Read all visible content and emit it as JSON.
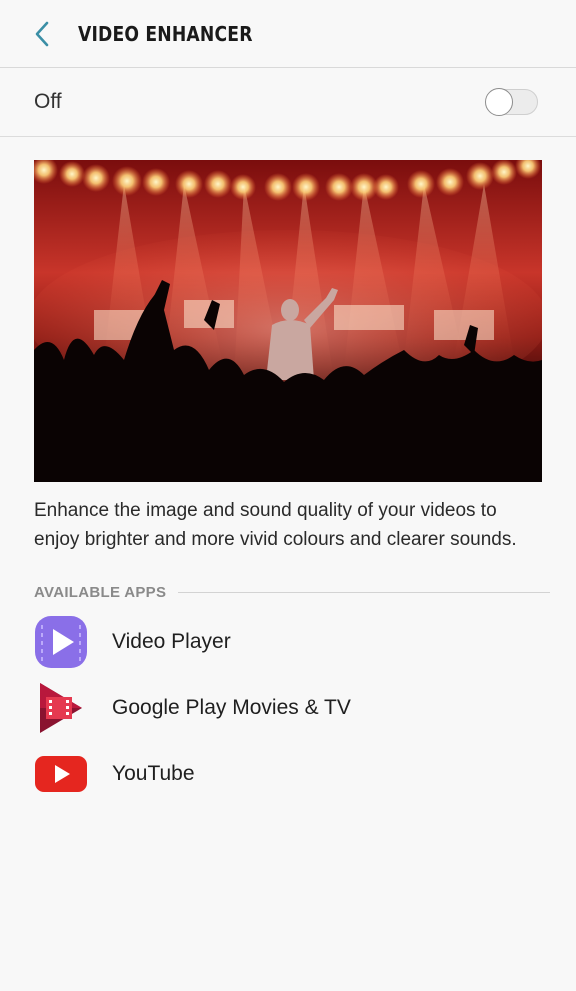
{
  "header": {
    "title": "VIDEO ENHANCER",
    "back_icon": "chevron-left-icon",
    "accent": "#3b8fa6"
  },
  "toggle": {
    "label": "Off",
    "state": false
  },
  "hero": {
    "description": "Concert crowd under stage lights"
  },
  "description": "Enhance the image and sound quality of your videos to enjoy brighter and more vivid colours and clearer sounds.",
  "section": {
    "label": "AVAILABLE APPS"
  },
  "apps": [
    {
      "name": "Video Player",
      "icon": "video-player-icon",
      "color": "#8a6fe8"
    },
    {
      "name": "Google Play Movies & TV",
      "icon": "play-movies-icon",
      "color": "#d0213b"
    },
    {
      "name": "YouTube",
      "icon": "youtube-icon",
      "color": "#e5261f"
    }
  ]
}
